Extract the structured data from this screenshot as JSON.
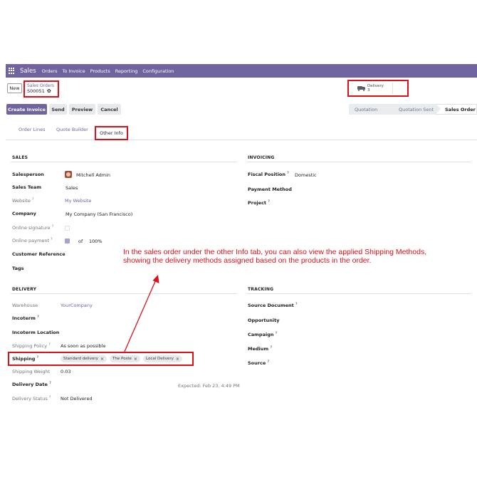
{
  "navbar": {
    "app_name": "Sales",
    "menu": [
      "Orders",
      "To Invoice",
      "Products",
      "Reporting",
      "Configuration"
    ]
  },
  "control_panel": {
    "new_label": "New",
    "breadcrumb_parent": "Sales Orders",
    "record_name": "S00051",
    "gear_icon": "gear-icon",
    "smart_button": {
      "label": "Delivery",
      "count": "3",
      "icon": "truck-icon"
    }
  },
  "actions": {
    "create_invoice": "Create Invoice",
    "send": "Send",
    "preview": "Preview",
    "cancel": "Cancel"
  },
  "status_bar": {
    "stages": [
      "Quotation",
      "Quotation Sent",
      "Sales Order"
    ],
    "active": "Sales Order"
  },
  "tabs": [
    "Order Lines",
    "Quote Builder",
    "Other Info"
  ],
  "active_tab": "Other Info",
  "help_mark": "?",
  "sales": {
    "title": "SALES",
    "salesperson_label": "Salesperson",
    "salesperson_value": "Mitchell Admin",
    "team_label": "Sales Team",
    "team_value": "Sales",
    "website_label": "Website",
    "website_value": "My Website",
    "company_label": "Company",
    "company_value": "My Company (San Francisco)",
    "online_signature_label": "Online signature",
    "online_payment_label": "Online payment",
    "online_payment_of": "of",
    "online_payment_pct": "100%",
    "customer_ref_label": "Customer Reference",
    "tags_label": "Tags"
  },
  "invoicing": {
    "title": "INVOICING",
    "fiscal_label": "Fiscal Position",
    "fiscal_value": "Domestic",
    "payment_method_label": "Payment Method",
    "project_label": "Project"
  },
  "delivery": {
    "title": "DELIVERY",
    "warehouse_label": "Warehouse",
    "warehouse_value": "YourCompany",
    "incoterm_label": "Incoterm",
    "incoterm_location_label": "Incoterm Location",
    "shipping_policy_label": "Shipping Policy",
    "shipping_policy_value": "As soon as possible",
    "shipping_label": "Shipping",
    "shipping_tags": [
      "Standard delivery",
      "The Poste",
      "Local Delivery"
    ],
    "tag_remove_glyph": "×",
    "weight_label": "Shipping Weight",
    "weight_value": "0.03",
    "delivery_date_label": "Delivery Date",
    "expected_text": "Expected: Feb 23, 4:49 PM",
    "status_label": "Delivery Status",
    "status_value": "Not Delivered"
  },
  "tracking": {
    "title": "TRACKING",
    "source_document_label": "Source Document",
    "opportunity_label": "Opportunity",
    "campaign_label": "Campaign",
    "medium_label": "Medium",
    "source_label": "Source"
  },
  "annotation": {
    "line1": "In the sales order under the other Info tab, you can also view the applied Shipping Methods,",
    "line2": "showing the delivery methods assigned based on the products in the order."
  },
  "colors": {
    "brand": "#71639e",
    "annotation_red": "#e0101a"
  }
}
